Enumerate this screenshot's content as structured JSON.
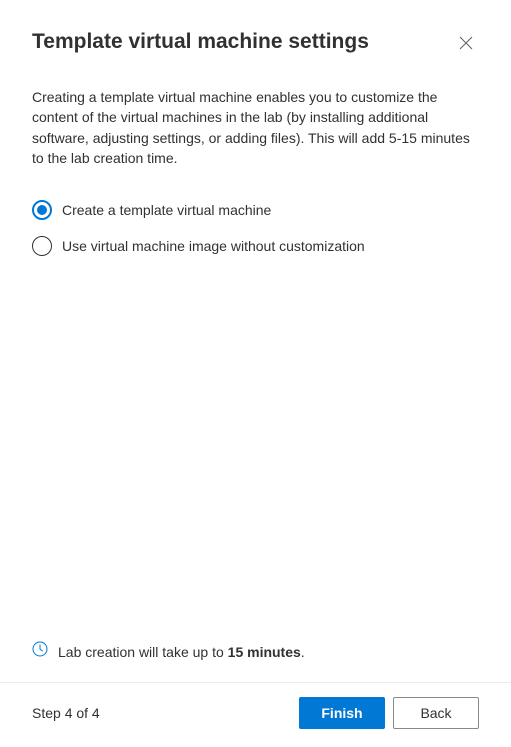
{
  "header": {
    "title": "Template virtual machine settings"
  },
  "content": {
    "description": "Creating a template virtual machine enables you to customize the content of the virtual machines in the lab (by installing additional software, adjusting settings, or adding files). This will add 5-15 minutes to the lab creation time.",
    "options": {
      "create_template": "Create a template virtual machine",
      "use_image": "Use virtual machine image without customization"
    }
  },
  "info": {
    "prefix": "Lab creation will take up to ",
    "duration": "15 minutes",
    "suffix": "."
  },
  "footer": {
    "step_label": "Step 4 of 4",
    "finish_label": "Finish",
    "back_label": "Back"
  },
  "colors": {
    "accent": "#0078d4"
  }
}
